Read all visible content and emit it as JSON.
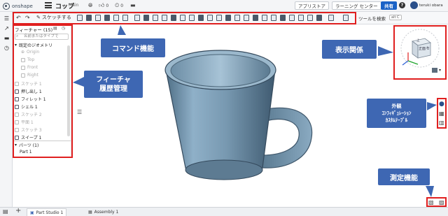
{
  "header": {
    "logo_text": "onshape",
    "doc_title": "コップ",
    "doc_branch": "Main",
    "likes": "0",
    "versions": "0",
    "app_store": "アプリストア",
    "learning_center": "ラーニング センター",
    "share": "共有",
    "help": "?",
    "user": "teruki obara"
  },
  "toolbar": {
    "sketch_label": "スケッチする",
    "tool_search": "ツールを検索",
    "tool_search_badge": "alt C"
  },
  "feature_panel": {
    "header": "フィーチャー (15)",
    "search_placeholder": "名前またはタイプで",
    "items": [
      {
        "label": "既定のジオメトリ",
        "muted": false
      },
      {
        "label": "Origin",
        "muted": true
      },
      {
        "label": "Top",
        "muted": true
      },
      {
        "label": "Front",
        "muted": true
      },
      {
        "label": "Right",
        "muted": true
      },
      {
        "label": "スケッチ 1",
        "muted": true
      },
      {
        "label": "押し出し 1",
        "muted": false
      },
      {
        "label": "フィレット 1",
        "muted": false
      },
      {
        "label": "シェル 1",
        "muted": false
      },
      {
        "label": "スケッチ 2",
        "muted": true
      },
      {
        "label": "平面 1",
        "muted": true
      },
      {
        "label": "スケッチ 3",
        "muted": true
      },
      {
        "label": "スイープ 1",
        "muted": false
      }
    ],
    "parts_header": "パーツ (1)",
    "parts": [
      "Part 1"
    ]
  },
  "callouts": {
    "command": "コマンド機能",
    "feature_line1": "フィーチャ",
    "feature_line2": "履歴管理",
    "view": "表示関係",
    "appearance_line1": "外観",
    "appearance_line2": "ｺﾝﾌｨｷﾞｭﾚｰｼｮﾝ",
    "appearance_line3": "ｶｽﾀﾑﾃｰﾌﾞﾙ",
    "measure": "測定機能"
  },
  "viewcube": {
    "face_label": "正面",
    "top_label": "上",
    "right_label": "右"
  },
  "tabs": [
    {
      "label": "Part Studio 1",
      "active": true
    },
    {
      "label": "Assembly 1",
      "active": false
    }
  ],
  "colors": {
    "accent": "#1a62c6",
    "callout": "#3e67b3",
    "highlight": "#e01f1f",
    "model": "#7a9ab2"
  }
}
